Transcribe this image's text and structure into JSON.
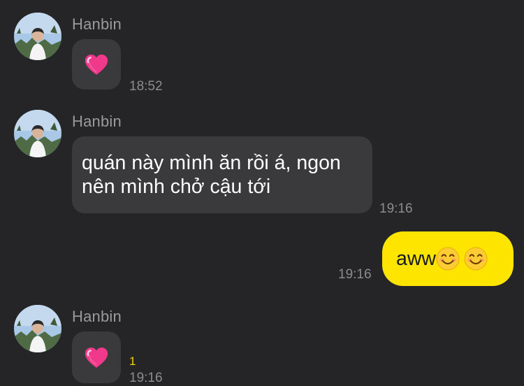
{
  "messages": [
    {
      "sender": "Hanbin",
      "content_icon": "pink-heart-icon",
      "time": "18:52"
    },
    {
      "sender": "Hanbin",
      "lines": [
        "quán này mình ăn rồi á, ngon",
        "nên mình chở cậu tới"
      ],
      "time": "19:16"
    },
    {
      "sender": "me",
      "text": "aww",
      "emoji": [
        "smiling-face-icon",
        "smiling-face-icon"
      ],
      "time": "19:16"
    },
    {
      "sender": "Hanbin",
      "content_icon": "pink-heart-icon",
      "unread_count": "1",
      "time": "19:16"
    }
  ],
  "colors": {
    "background": "#252527",
    "incoming_bubble": "#3a3a3c",
    "outgoing_bubble": "#fee500",
    "unread_count": "#f6d300"
  }
}
